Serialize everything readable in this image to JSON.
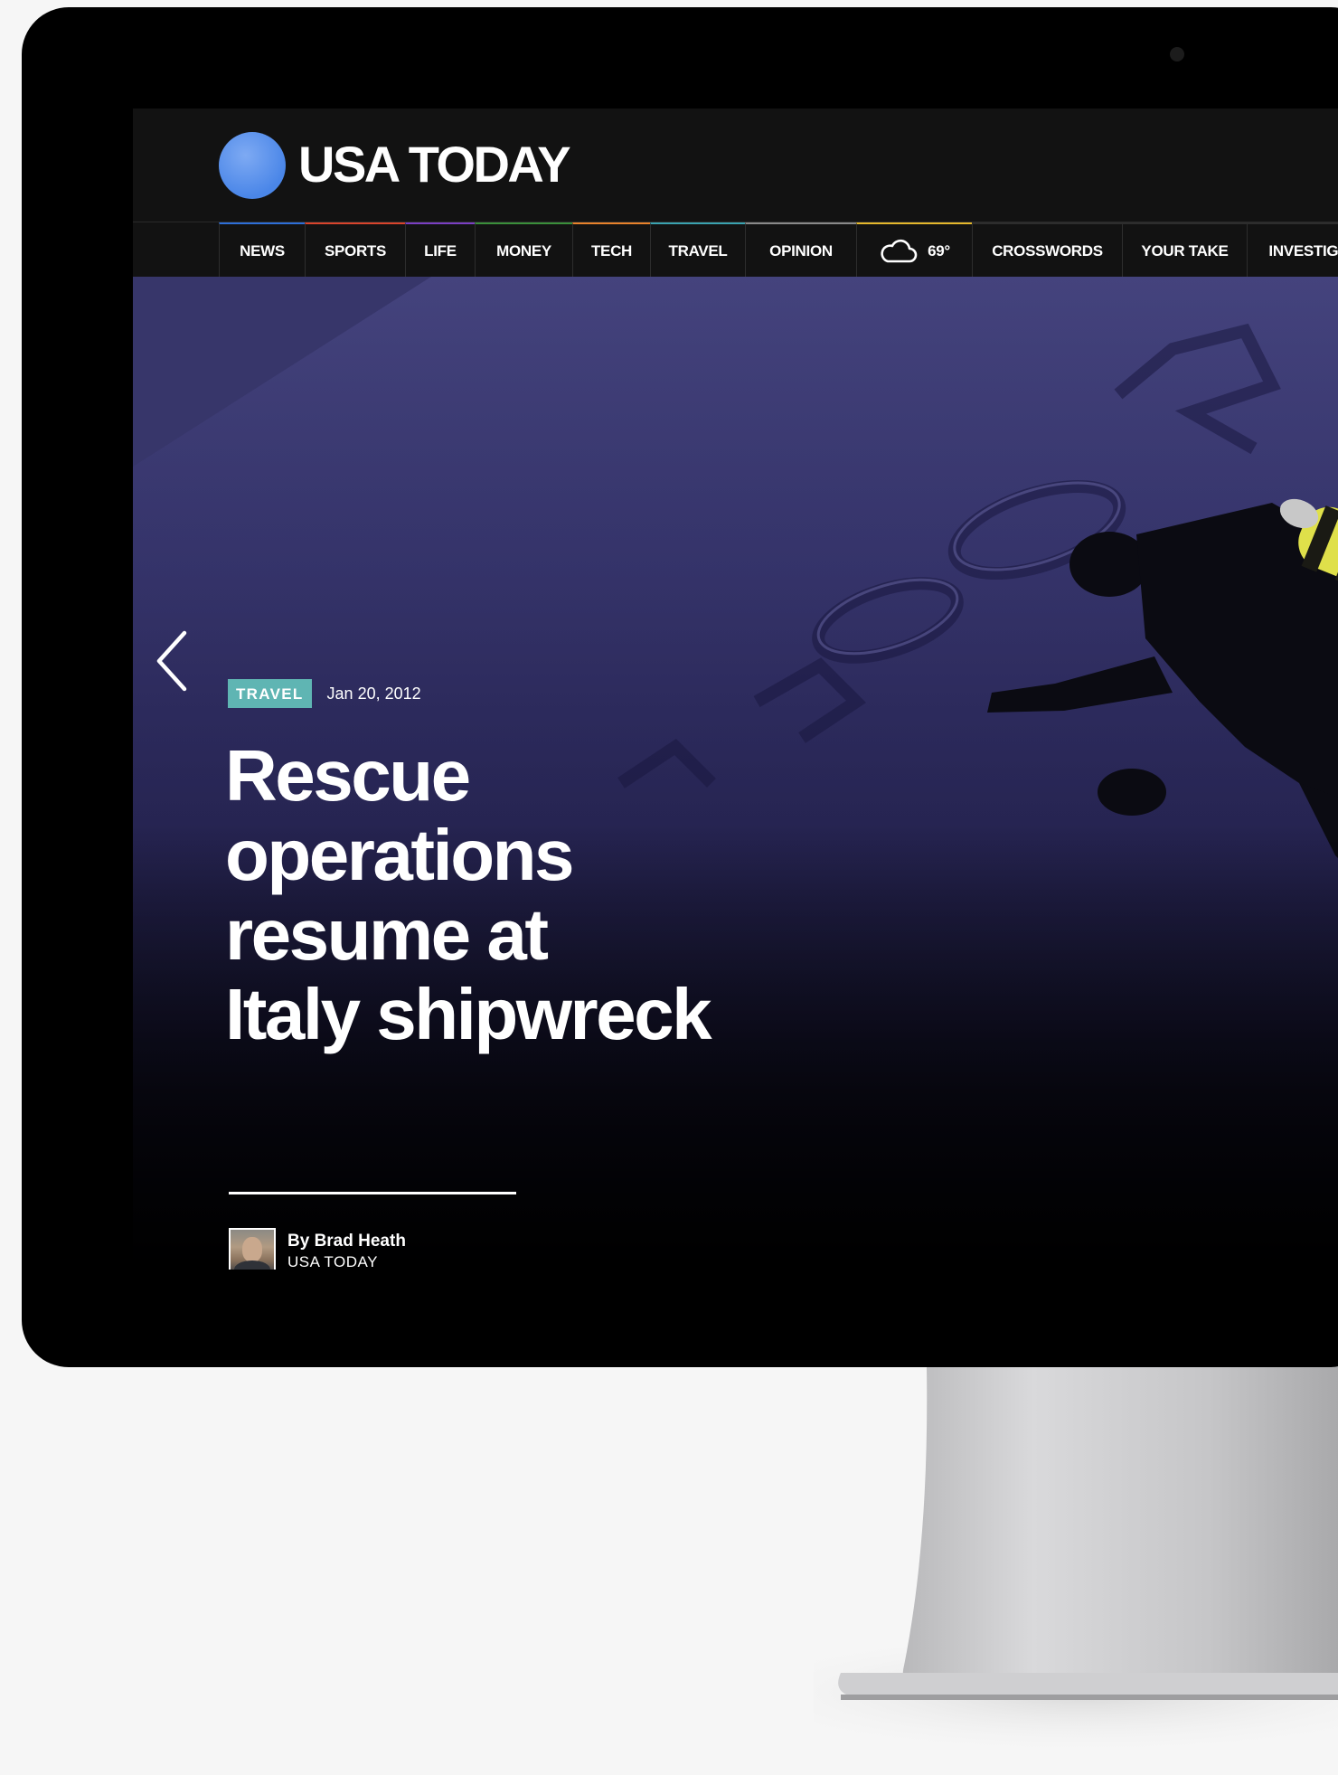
{
  "site": {
    "logo_text": "USA TODAY",
    "brand_color": "#4a86e8"
  },
  "nav": {
    "items": [
      {
        "label": "NEWS",
        "accent": "#2e6fd8"
      },
      {
        "label": "SPORTS",
        "accent": "#d9442c"
      },
      {
        "label": "LIFE",
        "accent": "#7b3fc4"
      },
      {
        "label": "MONEY",
        "accent": "#3a8f3a"
      },
      {
        "label": "TECH",
        "accent": "#e8822b"
      },
      {
        "label": "TRAVEL",
        "accent": "#3aa3b0"
      },
      {
        "label": "OPINION",
        "accent": "#8a8a8a"
      },
      {
        "label": "69°",
        "icon": "cloud-icon",
        "accent": "#e5b82c"
      },
      {
        "label": "CROSSWORDS",
        "accent": "#2d2d2d"
      },
      {
        "label": "YOUR TAKE",
        "accent": "#2d2d2d"
      },
      {
        "label": "INVESTIGATI",
        "accent": "#2d2d2d"
      }
    ]
  },
  "story": {
    "section": "TRAVEL",
    "section_color": "#5fb5b3",
    "date": "Jan 20, 2012",
    "headline_lines": [
      "Rescue",
      "operations",
      "resume at",
      "Italy shipwreck"
    ],
    "author": "By Brad Heath",
    "outlet": "USA TODAY"
  },
  "controls": {
    "prev_icon": "chevron-left-icon"
  }
}
